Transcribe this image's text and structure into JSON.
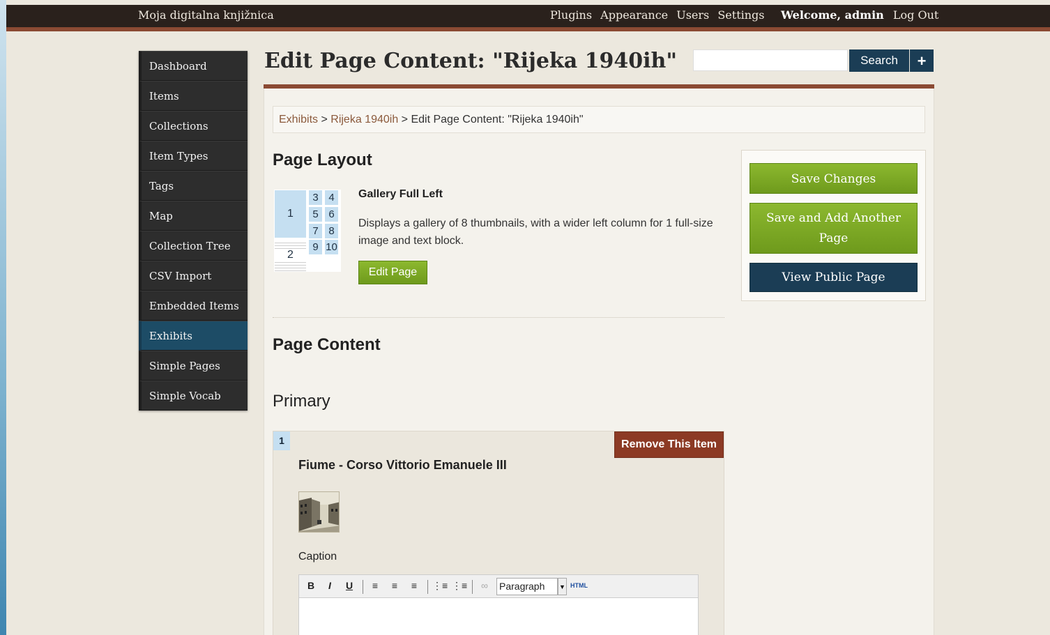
{
  "topbar": {
    "site_title": "Moja digitalna knjižnica",
    "nav": [
      "Plugins",
      "Appearance",
      "Users",
      "Settings"
    ],
    "welcome": "Welcome, admin",
    "logout": "Log Out"
  },
  "sidebar": {
    "items": [
      {
        "label": "Dashboard"
      },
      {
        "label": "Items"
      },
      {
        "label": "Collections"
      },
      {
        "label": "Item Types"
      },
      {
        "label": "Tags"
      },
      {
        "label": "Map"
      },
      {
        "label": "Collection Tree"
      },
      {
        "label": "CSV Import"
      },
      {
        "label": "Embedded Items"
      },
      {
        "label": "Exhibits"
      },
      {
        "label": "Simple Pages"
      },
      {
        "label": "Simple Vocab"
      }
    ],
    "active": "Exhibits"
  },
  "header": {
    "title": "Edit Page Content: \"Rijeka 1940ih\"",
    "search_value": "",
    "search_label": "Search",
    "plus_label": "+"
  },
  "breadcrumb": {
    "exhibits": "Exhibits",
    "sep1": " > ",
    "exhibit": "Rijeka 1940ih",
    "sep2": " > ",
    "current": "Edit Page Content: \"Rijeka 1940ih\""
  },
  "layout": {
    "heading": "Page Layout",
    "name": "Gallery Full Left",
    "description": "Displays a gallery of 8 thumbnails, with a wider left column for 1 full-size image and text block.",
    "edit_label": "Edit Page",
    "thumb_cells": [
      "1",
      "3",
      "4",
      "5",
      "6",
      "7",
      "8",
      "9",
      "10",
      "2"
    ]
  },
  "content": {
    "heading": "Page Content",
    "section": "Primary",
    "item_number": "1",
    "remove_label": "Remove This Item",
    "item_title": "Fiume - Corso Vittorio Emanuele III",
    "caption_label": "Caption",
    "format_value": "Paragraph",
    "html_label": "HTML"
  },
  "actions": {
    "save": "Save Changes",
    "save_add_line1": "Save and Add Another",
    "save_add_line2": "Page",
    "view_public": "View Public Page"
  }
}
